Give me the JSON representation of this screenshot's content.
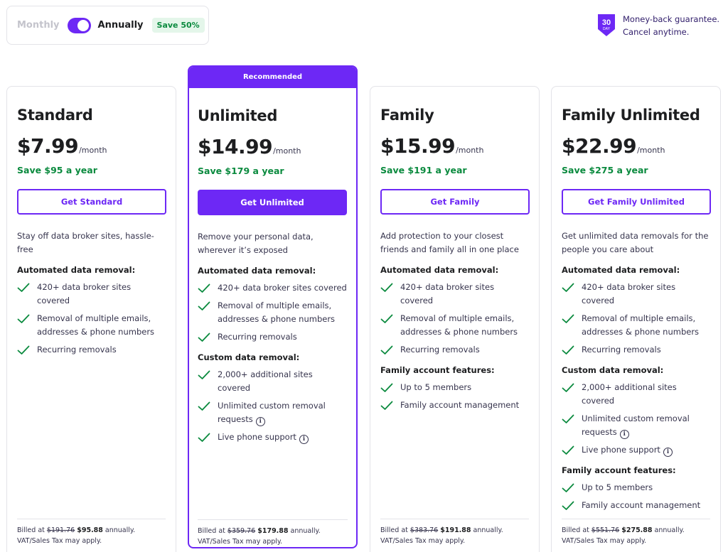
{
  "billing": {
    "monthly_label": "Monthly",
    "annually_label": "Annually",
    "save_badge": "Save 50%",
    "annually_selected": true
  },
  "guarantee": {
    "badge_number": "30",
    "badge_unit": "DAY",
    "line1": "Money-back guarantee.",
    "line2": "Cancel anytime."
  },
  "colors": {
    "accent": "#6d28f5",
    "save_green": "#0a8a3e"
  },
  "plans": [
    {
      "name": "Standard",
      "price": "$7.99",
      "per": "/month",
      "save": "Save $95 a year",
      "cta": "Get Standard",
      "description": "Stay off data broker sites, hassle-free",
      "sections": [
        {
          "title": "Automated data removal:",
          "features": [
            {
              "text": "420+ data broker sites covered"
            },
            {
              "text": "Removal of multiple emails, addresses & phone numbers"
            },
            {
              "text": "Recurring removals"
            }
          ]
        }
      ],
      "billed_prefix": "Billed at ",
      "billed_old": "$191.76",
      "billed_new": "$95.88",
      "billed_suffix": " annually.",
      "tax_note": "VAT/Sales Tax may apply."
    },
    {
      "name": "Unlimited",
      "recommended_label": "Recommended",
      "price": "$14.99",
      "per": "/month",
      "save": "Save $179 a year",
      "cta": "Get Unlimited",
      "description": "Remove your personal data, wherever it’s exposed",
      "sections": [
        {
          "title": "Automated data removal:",
          "features": [
            {
              "text": "420+ data broker sites covered"
            },
            {
              "text": "Removal of multiple emails, addresses & phone numbers"
            },
            {
              "text": "Recurring removals"
            }
          ]
        },
        {
          "title": "Custom data removal:",
          "features": [
            {
              "text": "2,000+ additional sites covered"
            },
            {
              "text": "Unlimited custom removal requests",
              "info": true
            },
            {
              "text": "Live phone support",
              "info": true
            }
          ]
        }
      ],
      "billed_prefix": "Billed at ",
      "billed_old": "$359.76",
      "billed_new": "$179.88",
      "billed_suffix": " annually.",
      "tax_note": "VAT/Sales Tax may apply."
    },
    {
      "name": "Family",
      "price": "$15.99",
      "per": "/month",
      "save": "Save $191 a year",
      "cta": "Get Family",
      "description": "Add protection to your closest friends and family all in one place",
      "sections": [
        {
          "title": "Automated data removal:",
          "features": [
            {
              "text": "420+ data broker sites covered"
            },
            {
              "text": "Removal of multiple emails, addresses & phone numbers"
            },
            {
              "text": "Recurring removals"
            }
          ]
        },
        {
          "title": "Family account features:",
          "features": [
            {
              "text": "Up to 5 members"
            },
            {
              "text": "Family account management"
            }
          ]
        }
      ],
      "billed_prefix": "Billed at ",
      "billed_old": "$383.76",
      "billed_new": "$191.88",
      "billed_suffix": " annually.",
      "tax_note": "VAT/Sales Tax may apply."
    },
    {
      "name": "Family Unlimited",
      "price": "$22.99",
      "per": "/month",
      "save": "Save $275 a year",
      "cta": "Get Family Unlimited",
      "description": "Get unlimited data removals for the people you care about",
      "sections": [
        {
          "title": "Automated data removal:",
          "features": [
            {
              "text": "420+ data broker sites covered"
            },
            {
              "text": "Removal of multiple emails, addresses & phone numbers"
            },
            {
              "text": "Recurring removals"
            }
          ]
        },
        {
          "title": "Custom data removal:",
          "features": [
            {
              "text": "2,000+ additional sites covered"
            },
            {
              "text": "Unlimited custom removal requests",
              "info": true
            },
            {
              "text": "Live phone support",
              "info": true
            }
          ]
        },
        {
          "title": "Family account features:",
          "features": [
            {
              "text": "Up to 5 members"
            },
            {
              "text": "Family account management"
            }
          ]
        }
      ],
      "billed_prefix": "Billed at ",
      "billed_old": "$551.76",
      "billed_new": "$275.88",
      "billed_suffix": " annually.",
      "tax_note": "VAT/Sales Tax may apply."
    }
  ]
}
